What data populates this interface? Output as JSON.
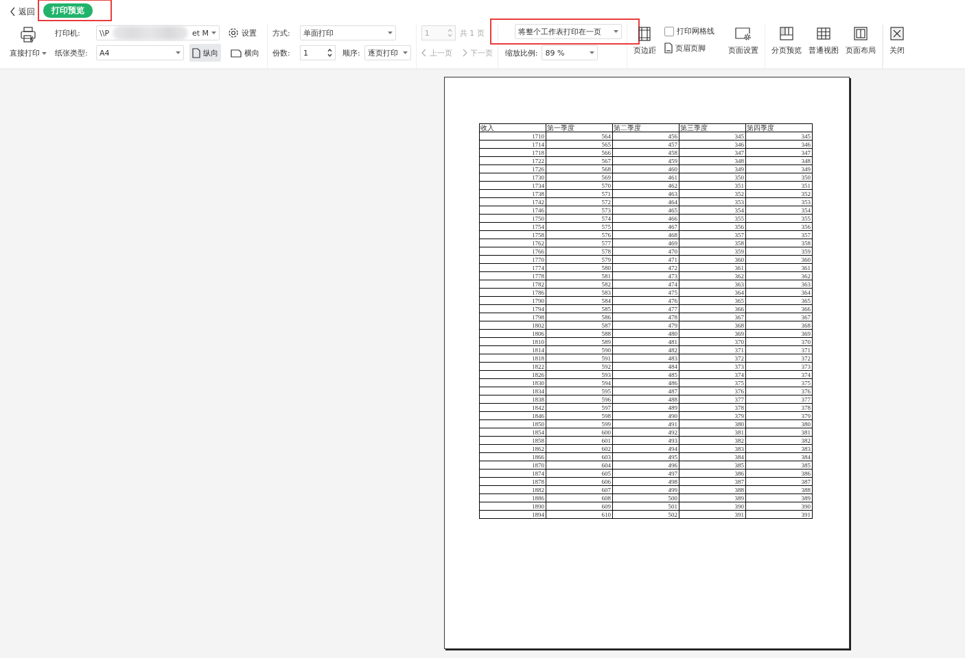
{
  "topbar": {
    "back": "返回",
    "mode_badge": {
      "label": "打印预览",
      "highlighted": true
    }
  },
  "toolbar": {
    "direct_print": "直接打印",
    "printer": {
      "label": "打印机:",
      "value_start": "\\\\P",
      "value_end": "et M"
    },
    "settings": "设置",
    "paper": {
      "label": "纸张类型:",
      "value": "A4"
    },
    "orientation": [
      {
        "label": "纵向",
        "kind": "portrait",
        "selected": true
      },
      {
        "label": "横向",
        "kind": "landscape",
        "selected": false
      }
    ],
    "mode": {
      "label": "方式:",
      "value": "单面打印"
    },
    "copies": {
      "label": "份数:",
      "value": "1"
    },
    "order": {
      "label": "顺序:",
      "value": "逐页打印"
    },
    "page": {
      "value": "1",
      "total": "共 1 页",
      "disabled": true
    },
    "nav": [
      {
        "label": "上一页",
        "disabled": true
      },
      {
        "label": "下一页",
        "disabled": true
      }
    ],
    "fit": {
      "value": "将整个工作表打印在一页",
      "highlighted": true
    },
    "zoom": {
      "label": "缩放比例:",
      "value": "89 %"
    },
    "margins": "页边距",
    "gridlines": {
      "label": "打印网格线",
      "checked": false
    },
    "header_footer": "页眉页脚",
    "page_setup": "页面设置",
    "views": [
      {
        "label": "分页预览",
        "kind": "pagebreak"
      },
      {
        "label": "普通视图",
        "kind": "normal"
      },
      {
        "label": "页面布局",
        "kind": "layout"
      }
    ],
    "close": "关闭"
  },
  "sheet": {
    "columns": [
      "收入",
      "第一季度",
      "第二季度",
      "第三季度",
      "第四季度"
    ],
    "rows": [
      [
        "1710",
        "564",
        "456",
        "345",
        "345"
      ],
      [
        "1714",
        "565",
        "457",
        "346",
        "346"
      ],
      [
        "1718",
        "566",
        "458",
        "347",
        "347"
      ],
      [
        "1722",
        "567",
        "459",
        "348",
        "348"
      ],
      [
        "1726",
        "568",
        "460",
        "349",
        "349"
      ],
      [
        "1730",
        "569",
        "461",
        "350",
        "350"
      ],
      [
        "1734",
        "570",
        "462",
        "351",
        "351"
      ],
      [
        "1738",
        "571",
        "463",
        "352",
        "352"
      ],
      [
        "1742",
        "572",
        "464",
        "353",
        "353"
      ],
      [
        "1746",
        "573",
        "465",
        "354",
        "354"
      ],
      [
        "1750",
        "574",
        "466",
        "355",
        "355"
      ],
      [
        "1754",
        "575",
        "467",
        "356",
        "356"
      ],
      [
        "1758",
        "576",
        "468",
        "357",
        "357"
      ],
      [
        "1762",
        "577",
        "469",
        "358",
        "358"
      ],
      [
        "1766",
        "578",
        "470",
        "359",
        "359"
      ],
      [
        "1770",
        "579",
        "471",
        "360",
        "360"
      ],
      [
        "1774",
        "580",
        "472",
        "361",
        "361"
      ],
      [
        "1778",
        "581",
        "473",
        "362",
        "362"
      ],
      [
        "1782",
        "582",
        "474",
        "363",
        "363"
      ],
      [
        "1786",
        "583",
        "475",
        "364",
        "364"
      ],
      [
        "1790",
        "584",
        "476",
        "365",
        "365"
      ],
      [
        "1794",
        "585",
        "477",
        "366",
        "366"
      ],
      [
        "1798",
        "586",
        "478",
        "367",
        "367"
      ],
      [
        "1802",
        "587",
        "479",
        "368",
        "368"
      ],
      [
        "1806",
        "588",
        "480",
        "369",
        "369"
      ],
      [
        "1810",
        "589",
        "481",
        "370",
        "370"
      ],
      [
        "1814",
        "590",
        "482",
        "371",
        "371"
      ],
      [
        "1818",
        "591",
        "483",
        "372",
        "372"
      ],
      [
        "1822",
        "592",
        "484",
        "373",
        "373"
      ],
      [
        "1826",
        "593",
        "485",
        "374",
        "374"
      ],
      [
        "1830",
        "594",
        "486",
        "375",
        "375"
      ],
      [
        "1834",
        "595",
        "487",
        "376",
        "376"
      ],
      [
        "1838",
        "596",
        "488",
        "377",
        "377"
      ],
      [
        "1842",
        "597",
        "489",
        "378",
        "378"
      ],
      [
        "1846",
        "598",
        "490",
        "379",
        "379"
      ],
      [
        "1850",
        "599",
        "491",
        "380",
        "380"
      ],
      [
        "1854",
        "600",
        "492",
        "381",
        "381"
      ],
      [
        "1858",
        "601",
        "493",
        "382",
        "382"
      ],
      [
        "1862",
        "602",
        "494",
        "383",
        "383"
      ],
      [
        "1866",
        "603",
        "495",
        "384",
        "384"
      ],
      [
        "1870",
        "604",
        "496",
        "385",
        "385"
      ],
      [
        "1874",
        "605",
        "497",
        "386",
        "386"
      ],
      [
        "1878",
        "606",
        "498",
        "387",
        "387"
      ],
      [
        "1882",
        "607",
        "499",
        "388",
        "388"
      ],
      [
        "1886",
        "608",
        "500",
        "389",
        "389"
      ],
      [
        "1890",
        "609",
        "501",
        "390",
        "390"
      ],
      [
        "1894",
        "610",
        "502",
        "391",
        "391"
      ]
    ]
  }
}
